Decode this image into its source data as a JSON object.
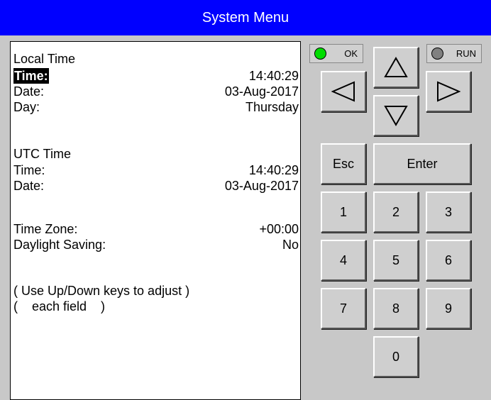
{
  "title": "System Menu",
  "colors": {
    "title_bar": "#0000ff",
    "ok_led": "#00dd00",
    "run_led": "#808080"
  },
  "display": {
    "local_time": {
      "header": "Local Time",
      "time_label": "Time:",
      "time_value": "14:40:29",
      "date_label": "Date:",
      "date_value": "03-Aug-2017",
      "day_label": "Day:",
      "day_value": "Thursday"
    },
    "utc_time": {
      "header": "UTC Time",
      "time_label": "Time:",
      "time_value": "14:40:29",
      "date_label": "Date:",
      "date_value": "03-Aug-2017"
    },
    "time_zone_label": "Time Zone:",
    "time_zone_value": "+00:00",
    "daylight_label": "Daylight Saving:",
    "daylight_value": "No",
    "hint_line1": "( Use Up/Down keys to adjust )",
    "hint_line2": "(    each field    )"
  },
  "indicators": {
    "ok_label": "OK",
    "run_label": "RUN"
  },
  "keypad": {
    "esc": "Esc",
    "enter": "Enter",
    "k1": "1",
    "k2": "2",
    "k3": "3",
    "k4": "4",
    "k5": "5",
    "k6": "6",
    "k7": "7",
    "k8": "8",
    "k9": "9",
    "k0": "0",
    "arrows": [
      "up-arrow-icon",
      "down-arrow-icon",
      "left-arrow-icon",
      "right-arrow-icon"
    ]
  }
}
